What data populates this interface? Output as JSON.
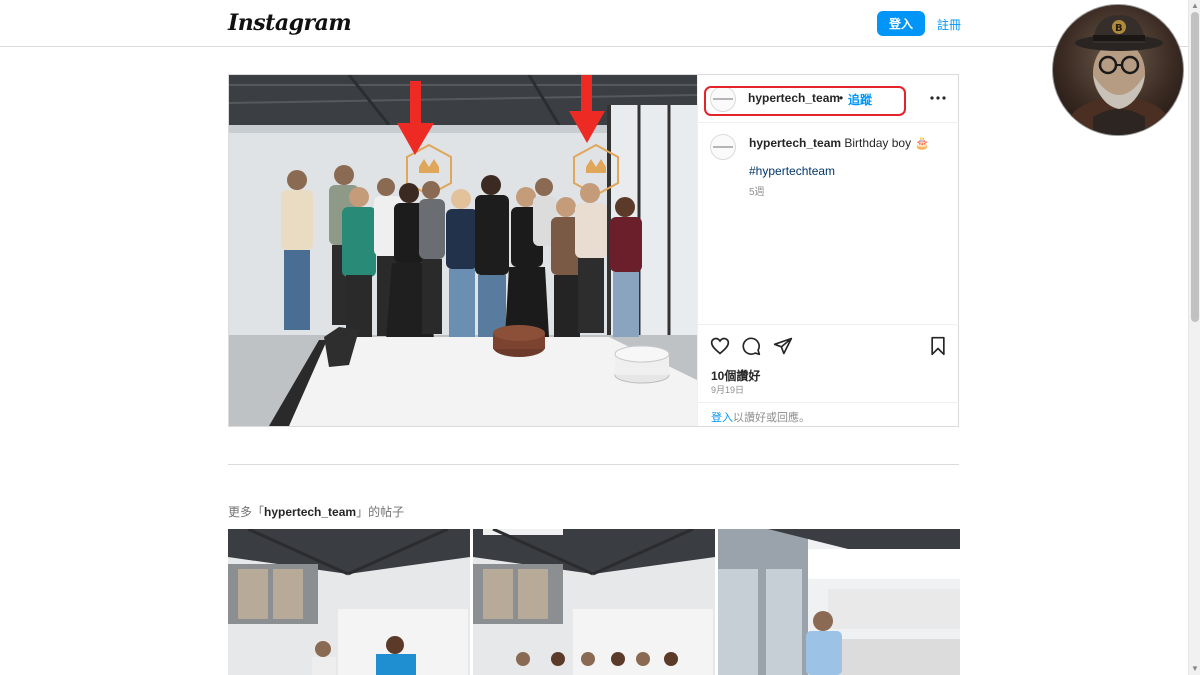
{
  "nav": {
    "logo": "Instagram",
    "login_label": "登入",
    "signup_label": "註冊"
  },
  "post": {
    "username": "hypertech_team",
    "follow_dot": "•",
    "follow_label": "追蹤",
    "caption_text": "Birthday boy",
    "caption_emoji": "🎂",
    "hashtag": "#hypertechteam",
    "age": "5週",
    "likes": "10個讚好",
    "date": "9月19日",
    "login_prompt_link": "登入",
    "login_prompt_rest": "以讚好或回應。"
  },
  "more_posts": {
    "prefix": "更多「",
    "username": "hypertech_team",
    "suffix": "」的帖子"
  },
  "icons": {
    "header_more": "more-horizontal-icon",
    "like": "heart-icon",
    "comment": "comment-icon",
    "share": "paper-plane-icon",
    "save": "bookmark-icon"
  },
  "colors": {
    "accent": "#0095f6",
    "highlight_outline": "#e3242b",
    "annotation_arrow": "#ee2a24"
  }
}
